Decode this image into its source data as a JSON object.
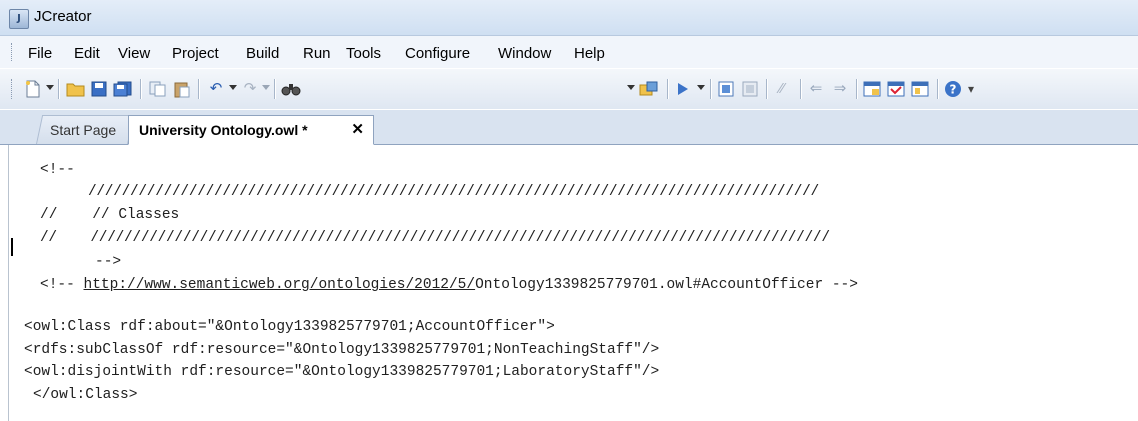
{
  "window": {
    "title": "JCreator",
    "app_icon": "jcreator-icon"
  },
  "menu": [
    "File",
    "Edit",
    "View",
    "Project",
    "Build",
    "Run",
    "Tools",
    "Configure",
    "Window",
    "Help"
  ],
  "toolbar": {
    "left_icons": [
      "new-file-icon",
      "open-folder-icon",
      "save-icon",
      "save-all-icon",
      "copy-icon",
      "paste-icon",
      "undo-icon",
      "redo-icon",
      "find-icon"
    ],
    "right_icons": [
      "build-icon",
      "run-icon",
      "compile-icon",
      "debug-icon",
      "tool-icon",
      "back-icon",
      "forward-icon",
      "window-icon",
      "window2-icon",
      "window3-icon",
      "help-icon"
    ]
  },
  "tabs": {
    "start_page": "Start Page",
    "active_file": "University Ontology.owl *",
    "close_glyph": "✕"
  },
  "code": {
    "line1": "<!--",
    "line2": "///////////////////////////////////////////////////////////////////////////////////////",
    "line3_prefix": "//    // Classes",
    "line4": "//    ////////////////////////////////////////////////////////////////////////////////////////",
    "line5": "-->",
    "line6_open": "<!-- ",
    "line6_url": "http://www.semanticweb.org/ontologies/2012/5/",
    "line6_rest": "Ontology1339825779701.owl#AccountOfficer -->",
    "line7": "<owl:Class rdf:about=\"&Ontology1339825779701;AccountOfficer\">",
    "line8": "<rdfs:subClassOf rdf:resource=\"&Ontology1339825779701;NonTeachingStaff\"/>",
    "line9": "<owl:disjointWith rdf:resource=\"&Ontology1339825779701;LaboratoryStaff\"/>",
    "line10": "</owl:Class>"
  }
}
